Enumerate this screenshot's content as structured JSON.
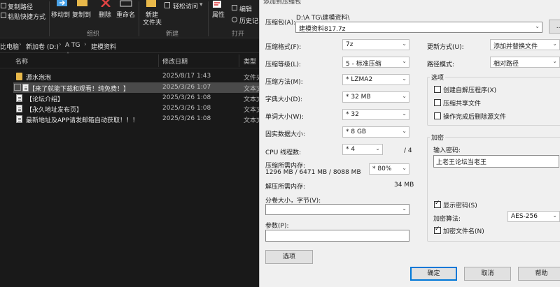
{
  "explorer": {
    "ribbon": {
      "copy_path": "复制路径",
      "paste_shortcut": "粘贴快捷方式",
      "move_to": "移动到",
      "copy_to": "复制到",
      "delete": "删除",
      "rename": "重命名",
      "new_folder_line1": "新建",
      "new_folder_line2": "文件夹",
      "easy_access": "轻松访问",
      "properties": "属性",
      "edit": "编辑",
      "history": "历史记",
      "group_organize": "组织",
      "group_new": "新建",
      "group_open": "打开"
    },
    "breadcrumb": [
      "比电脑",
      "新加卷 (D:)",
      "A TG",
      "建模资料"
    ],
    "columns": {
      "name": "名称",
      "modified": "修改日期",
      "type": "类型"
    },
    "files": [
      {
        "name": "源水泡泡",
        "modified": "2025/8/17 1:43",
        "type": "文件夹",
        "icon": "folder-icon",
        "selected": false
      },
      {
        "name": "【来了就能下载和观看！纯免费！】",
        "modified": "2025/3/26 1:07",
        "type": "文本文",
        "icon": "text-file-icon",
        "selected": true
      },
      {
        "name": "【论坛介绍】",
        "modified": "2025/3/26 1:08",
        "type": "文本文",
        "icon": "text-file-icon",
        "selected": false
      },
      {
        "name": "【永久地址发布页】",
        "modified": "2025/3/26 1:08",
        "type": "文本文",
        "icon": "text-file-icon",
        "selected": false
      },
      {
        "name": "最新地址及APP请发邮箱自动获取！！！",
        "modified": "2025/3/26 1:08",
        "type": "文本文",
        "icon": "text-file-icon",
        "selected": false
      }
    ]
  },
  "dialog": {
    "title": "添加到压缩包",
    "archive_label": "压缩包(A):",
    "archive_path": "D:\\A TG\\建模资料\\",
    "archive_name": "建模资料817.7z",
    "browse_label": "...",
    "format_label": "压缩格式(F):",
    "format_value": "7z",
    "level_label": "压缩等级(L):",
    "level_value": "5 - 标准压缩",
    "method_label": "压缩方法(M):",
    "method_value": "* LZMA2",
    "dict_label": "字典大小(D):",
    "dict_value": "* 32 MB",
    "word_label": "单词大小(W):",
    "word_value": "* 32",
    "solid_label": "固实数据大小:",
    "solid_value": "* 8 GB",
    "cpu_label": "CPU 线程数:",
    "cpu_value": "* 4",
    "cpu_total": "/ 4",
    "mem_comp_label": "压缩所需内存:",
    "mem_comp_value": "1296 MB / 6471 MB / 8088 MB",
    "mem_percent": "* 80%",
    "mem_decomp_label": "解压所需内存:",
    "mem_decomp_value": "34 MB",
    "split_label": "分卷大小，字节(V):",
    "params_label": "参数(P):",
    "options_button": "选项",
    "update_label": "更新方式(U):",
    "update_value": "添加并替换文件",
    "path_label": "路径模式:",
    "path_value": "相对路径",
    "options_group": "选项",
    "opt_sfx": "创建自解压程序(X)",
    "opt_shared": "压缩共享文件",
    "opt_delete": "操作完成后删除源文件",
    "encrypt_group": "加密",
    "password_label": "输入密码:",
    "password_value": "上老王论坛当老王",
    "show_password": "显示密码(S)",
    "enc_method_label": "加密算法:",
    "enc_method_value": "AES-256",
    "encrypt_names": "加密文件名(N)",
    "ok": "确定",
    "cancel": "取消",
    "help": "帮助"
  }
}
